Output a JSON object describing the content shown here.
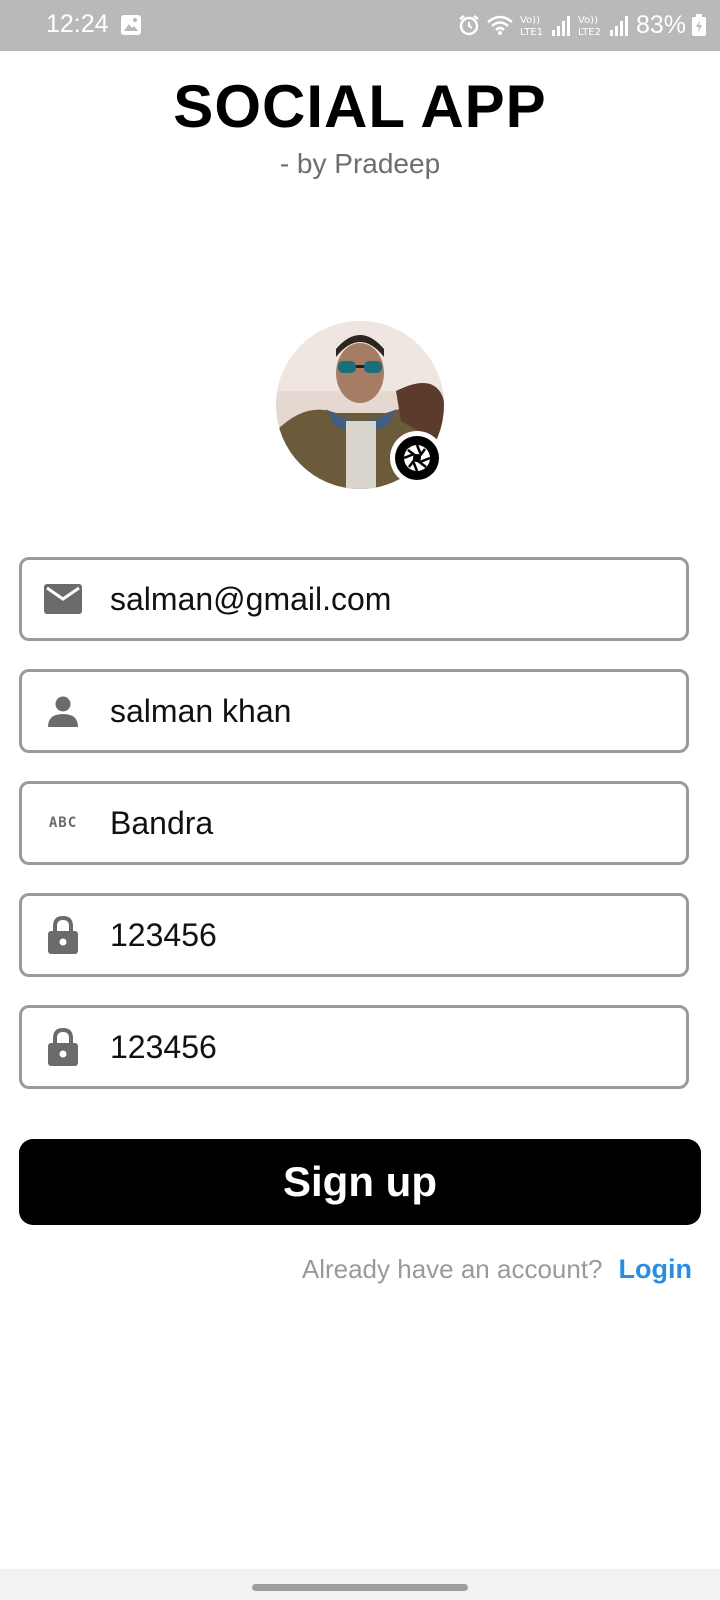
{
  "status_bar": {
    "time": "12:24",
    "battery": "83%",
    "icons": [
      "gallery-icon",
      "alarm-icon",
      "wifi-icon",
      "signal-lte1-icon",
      "signal-lte2-icon",
      "battery-charging-icon"
    ]
  },
  "header": {
    "title": "SOCIAL APP",
    "subtitle": "- by Pradeep"
  },
  "avatar": {
    "icon": "camera-shutter-icon"
  },
  "form": {
    "email": {
      "value": "salman@gmail.com",
      "icon": "mail-icon"
    },
    "name": {
      "value": "salman khan",
      "icon": "person-icon"
    },
    "address": {
      "value": "Bandra",
      "icon": "abc-icon",
      "icon_text": "ABC"
    },
    "password": {
      "value": "123456",
      "icon": "lock-icon"
    },
    "confirm_password": {
      "value": "123456",
      "icon": "lock-icon"
    }
  },
  "signup_button": {
    "label": "Sign up",
    "background": "#000000"
  },
  "login_row": {
    "prompt": "Already have an account?",
    "link": "Login",
    "link_color": "#2a8de0"
  }
}
